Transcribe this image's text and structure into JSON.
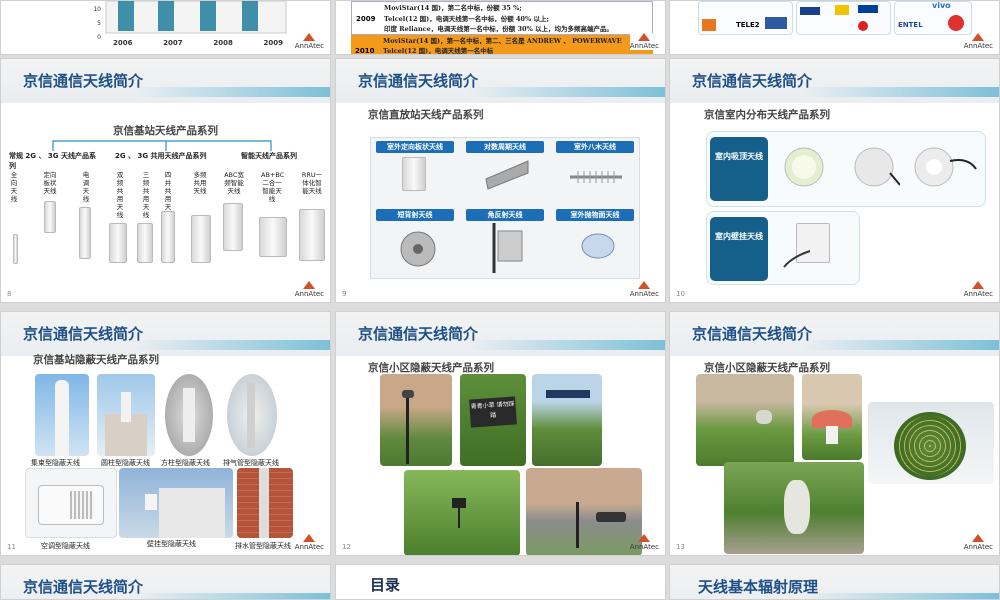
{
  "top_left": {
    "years": [
      "2006",
      "2007",
      "2008",
      "2009"
    ],
    "yticks": [
      "10",
      "5",
      "0"
    ],
    "logo": "AnnAtec"
  },
  "top_mid": {
    "rows": [
      {
        "year": "2009",
        "lines": [
          "MoviStar(14 国)，第二名中标，份额 35 %;",
          "Telcel(12 国)，电调天线第一名中标，份额 40% 以上;",
          "印度 Reliance，电调天线第一名中标，份额 30% 以上，均为多频高端产品。"
        ]
      },
      {
        "year": "2010",
        "lines": [
          "MoviStar(14 国)，第一名中标，第二、三名是 ANDREW 、 POWERWAVE",
          "Telcel(12 国)，电调天线第一名中标"
        ]
      }
    ],
    "logo": "AnnAtec"
  },
  "top_right": {
    "brands": [
      "TELE2",
      "vivo",
      "ENTEL",
      "Telecom"
    ],
    "logo": "AnnAtec"
  },
  "s8": {
    "title": "京信通信天线简介",
    "subtitle": "京信基站天线产品系列",
    "groups": [
      "常规 2G 、 3G 天线产品系列",
      "2G 、 3G 共用天线产品系列",
      "智能天线产品系列"
    ],
    "items": [
      "全向天线",
      "定向板状天线",
      "电调天线",
      "双频共用天线",
      "三频共用天线",
      "四井共用天线",
      "多频共用天线",
      "ABC宽频智能天线",
      "AB+BC二合一智能天线",
      "RRU一体化智能天线"
    ],
    "page": "8",
    "logo": "AnnAtec"
  },
  "s9": {
    "title": "京信通信天线简介",
    "subtitle": "京信直放站天线产品系列",
    "tags": [
      "室外定向板状天线",
      "对数周期天线",
      "室外八木天线",
      "短背射天线",
      "角反射天线",
      "室外抛物面天线"
    ],
    "page": "9",
    "logo": "AnnAtec"
  },
  "s10": {
    "title": "京信通信天线简介",
    "subtitle": "京信室内分布天线产品系列",
    "ceiling_label": "室内吸顶天线",
    "wall_label": "室内壁挂天线",
    "page": "10",
    "logo": "AnnAtec"
  },
  "s11": {
    "title": "京信通信天线简介",
    "subtitle": "京信基站隐蔽天线产品系列",
    "captions": [
      "集束型隐蔽天线",
      "圆柱型隐蔽天线",
      "方柱型隐蔽天线",
      "排气管型隐蔽天线",
      "空调型隐蔽天线",
      "壁挂型隐蔽天线",
      "排水管型隐蔽天线"
    ],
    "page": "11",
    "logo": "AnnAtec"
  },
  "s12": {
    "title": "京信通信天线简介",
    "subtitle": "京信小区隐蔽天线产品系列",
    "sign_text": "青青小草 请勿踩踏",
    "page": "12",
    "logo": "AnnAtec"
  },
  "s13": {
    "title": "京信通信天线简介",
    "subtitle": "京信小区隐蔽天线产品系列",
    "page": "13",
    "logo": "AnnAtec"
  },
  "b1": {
    "title": "京信通信天线简介"
  },
  "b2": {
    "title": "目录"
  },
  "b3": {
    "title": "天线基本辐射原理"
  }
}
